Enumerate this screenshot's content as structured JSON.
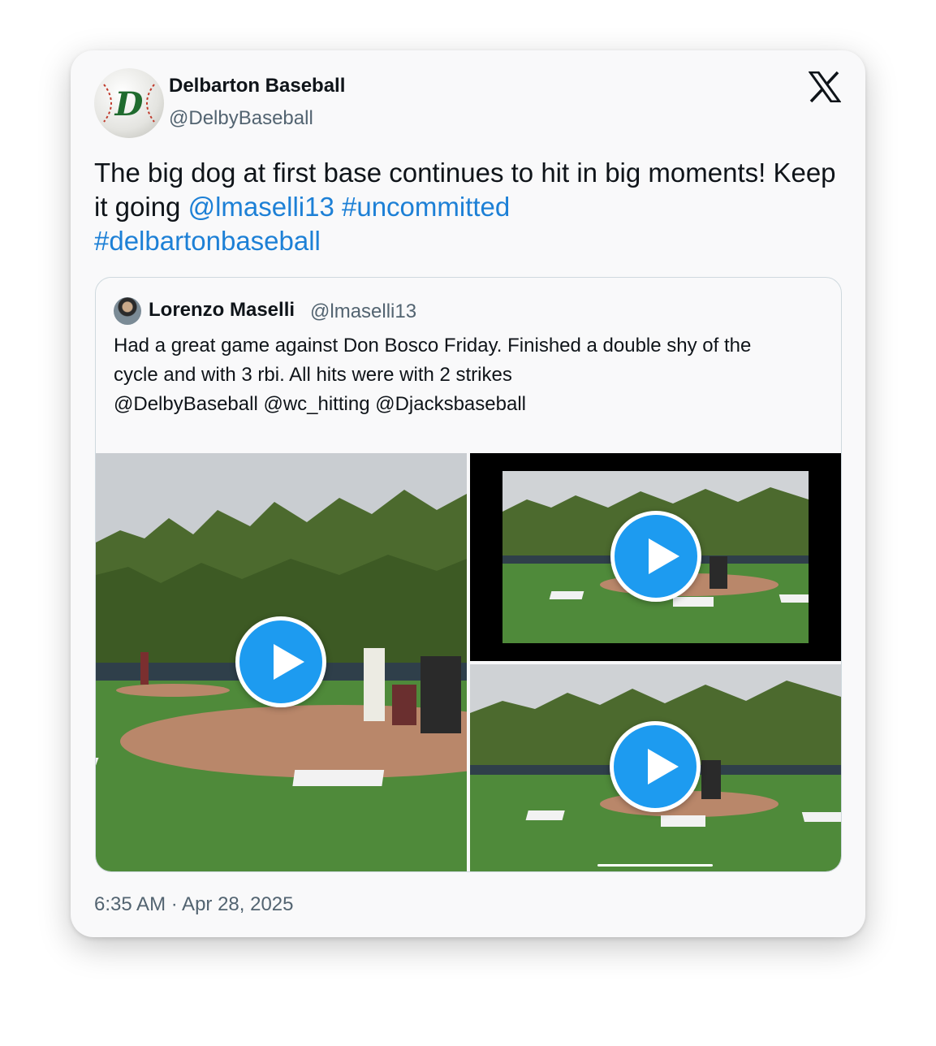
{
  "author": {
    "name": "Delbarton Baseball",
    "handle": "@DelbyBaseball",
    "avatar_icon": "baseball-d-logo"
  },
  "platform_icon": "x-logo-icon",
  "tweet": {
    "text_plain": "The big dog at first base continues to hit in big moments! Keep it going ",
    "mention": "@lmaselli13",
    "hashtag1": "#uncommitted",
    "hashtag2": "#delbartonbaseball"
  },
  "quoted": {
    "name": "Lorenzo Maselli",
    "handle": "@lmaselli13",
    "line1": "Had a great game against Don Bosco Friday. Finished a double shy of the",
    "line2": "cycle and with 3 rbi. All hits were with 2 strikes",
    "line3": "@DelbyBaseball @wc_hitting @Djacksbaseball"
  },
  "media": [
    {
      "type": "video",
      "icon": "play-icon"
    },
    {
      "type": "video",
      "icon": "play-icon"
    },
    {
      "type": "video",
      "icon": "play-icon"
    }
  ],
  "timestamp": "6:35 AM · Apr 28, 2025",
  "colors": {
    "link": "#1d80d6",
    "play": "#1d9bf0",
    "text": "#0f1419",
    "muted": "#536471"
  }
}
